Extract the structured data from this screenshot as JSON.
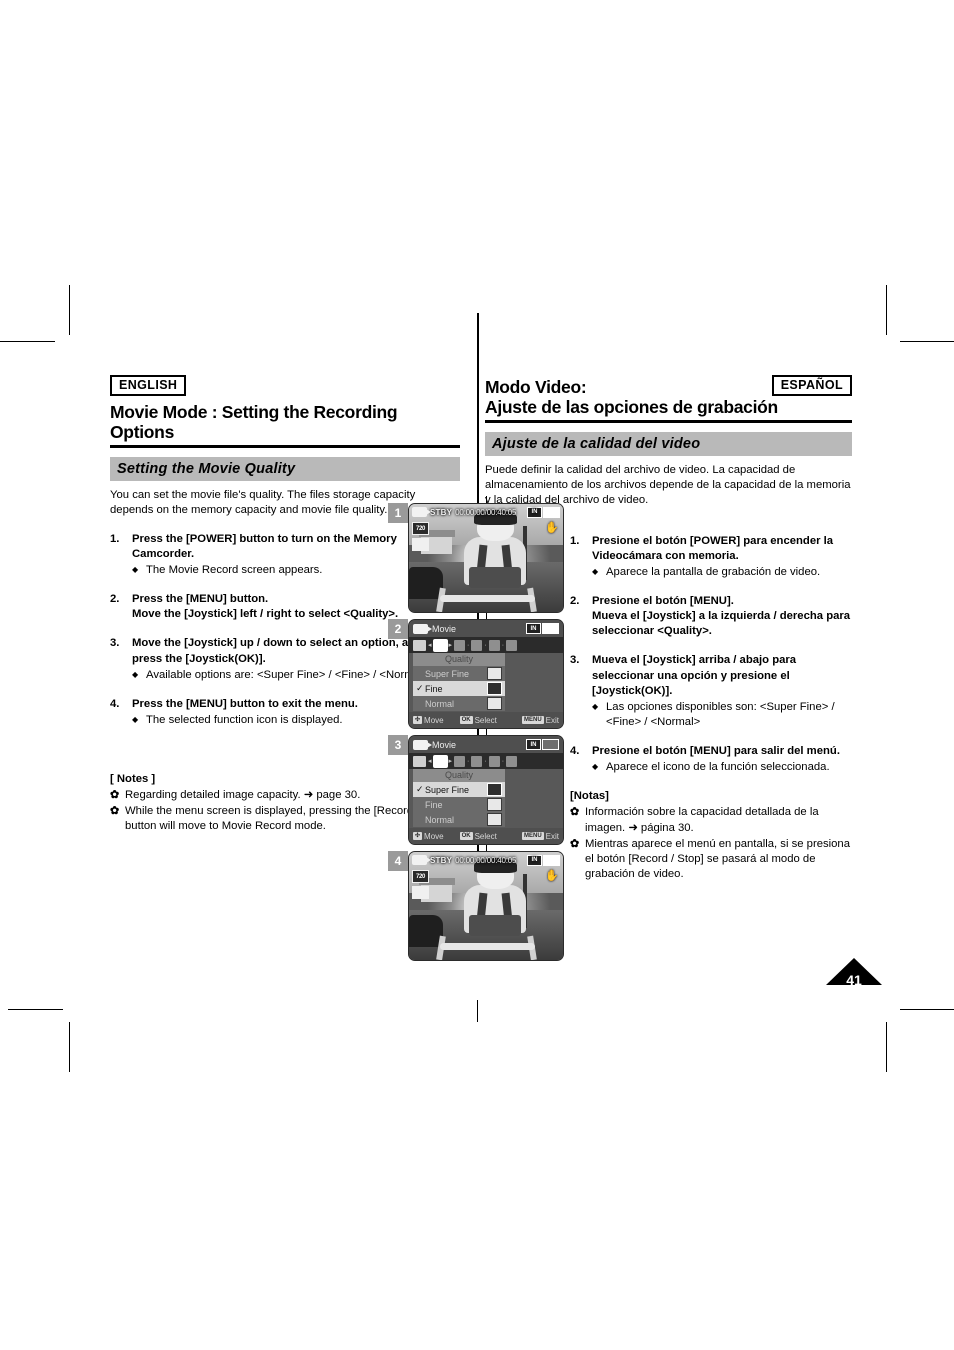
{
  "english": {
    "lang_tag": "ENGLISH",
    "title": "Movie Mode : Setting the Recording Options",
    "section_band": "Setting the Movie Quality",
    "intro": "You can set the movie file's quality. The files storage capacity depends on the memory capacity and movie file quality.",
    "steps": [
      {
        "num": "1.",
        "head": "Press the [POWER] button to turn on the Memory Camcorder.",
        "subs": [
          "The Movie Record screen appears."
        ]
      },
      {
        "num": "2.",
        "head": "Press the [MENU] button.\nMove the [Joystick] left / right to select <Quality>.",
        "subs": []
      },
      {
        "num": "3.",
        "head": "Move the [Joystick] up / down to select an option, and then press the [Joystick(OK)].",
        "subs": [
          "Available options are: <Super Fine> / <Fine> / <Normal>"
        ]
      },
      {
        "num": "4.",
        "head": "Press the [MENU] button to exit the menu.",
        "subs": [
          "The selected function icon is displayed."
        ]
      }
    ],
    "notes_title": "[ Notes ]",
    "notes": [
      "Regarding detailed image capacity. ➜ page 30.",
      "While the menu screen is displayed, pressing the [Record / Stop] button will move to Movie Record mode."
    ]
  },
  "spanish": {
    "lang_tag": "ESPAÑOL",
    "title_line1": "Modo Video:",
    "title_line2": "Ajuste de las opciones de grabación",
    "section_band": "Ajuste de la calidad del video",
    "intro": "Puede definir la calidad del archivo de video. La capacidad de almacenamiento de los archivos depende de la capacidad de la memoria y la calidad del archivo de video.",
    "steps": [
      {
        "num": "1.",
        "head": "Presione el botón [POWER] para encender la Videocámara con memoria.",
        "subs": [
          "Aparece la pantalla de grabación de video."
        ]
      },
      {
        "num": "2.",
        "head": "Presione el botón [MENU].\nMueva el [Joystick] a la izquierda / derecha para seleccionar <Quality>.",
        "subs": []
      },
      {
        "num": "3.",
        "head": "Mueva el [Joystick] arriba / abajo para seleccionar una opción y presione el [Joystick(OK)].",
        "subs": [
          "Las opciones disponibles son: <Super Fine> / <Fine> / <Normal>"
        ]
      },
      {
        "num": "4.",
        "head": "Presione el botón [MENU] para salir del menú.",
        "subs": [
          "Aparece el icono de la función seleccionada."
        ]
      }
    ],
    "notes_title": "[Notas]",
    "notes": [
      "Información sobre la capacidad detallada de la imagen. ➜ página 30.",
      "Mientras aparece el menú en pantalla, si se presiona el botón [Record / Stop] se pasará al modo de grabación de video."
    ]
  },
  "figures": [
    {
      "badge": "1",
      "type": "record",
      "osd": {
        "mode_icon": "movie-camera-icon",
        "status": "STBY",
        "timecode": "00:00:00/00:40:05",
        "battery": "IN",
        "left_chips": [
          "720",
          "quality-superfine-icon"
        ],
        "hand_icon": "anti-shake-icon"
      }
    },
    {
      "badge": "2",
      "type": "menu",
      "title": "Movie",
      "battery": "IN",
      "option_title": "Quality",
      "options": [
        {
          "label": "Super Fine",
          "checked": false,
          "active": false
        },
        {
          "label": "Fine",
          "checked": true,
          "active": true
        },
        {
          "label": "Normal",
          "checked": false,
          "active": false
        }
      ],
      "hints": [
        {
          "key": "✣",
          "label": "Move"
        },
        {
          "key": "OK",
          "label": "Select"
        },
        {
          "key": "MENU",
          "label": "Exit"
        }
      ]
    },
    {
      "badge": "3",
      "type": "menu",
      "title": "Movie",
      "battery": "IN",
      "option_title": "Quality",
      "options": [
        {
          "label": "Super Fine",
          "checked": true,
          "active": true
        },
        {
          "label": "Fine",
          "checked": false,
          "active": false
        },
        {
          "label": "Normal",
          "checked": false,
          "active": false
        }
      ],
      "hints": [
        {
          "key": "✣",
          "label": "Move"
        },
        {
          "key": "OK",
          "label": "Select"
        },
        {
          "key": "MENU",
          "label": "Exit"
        }
      ]
    },
    {
      "badge": "4",
      "type": "record",
      "osd": {
        "mode_icon": "movie-camera-icon",
        "status": "STBY",
        "timecode": "00:00:00/00:40:05",
        "battery": "IN",
        "left_chips": [
          "720",
          "quality-superfine-icon"
        ],
        "hand_icon": "anti-shake-icon"
      }
    }
  ],
  "page_number": "41"
}
